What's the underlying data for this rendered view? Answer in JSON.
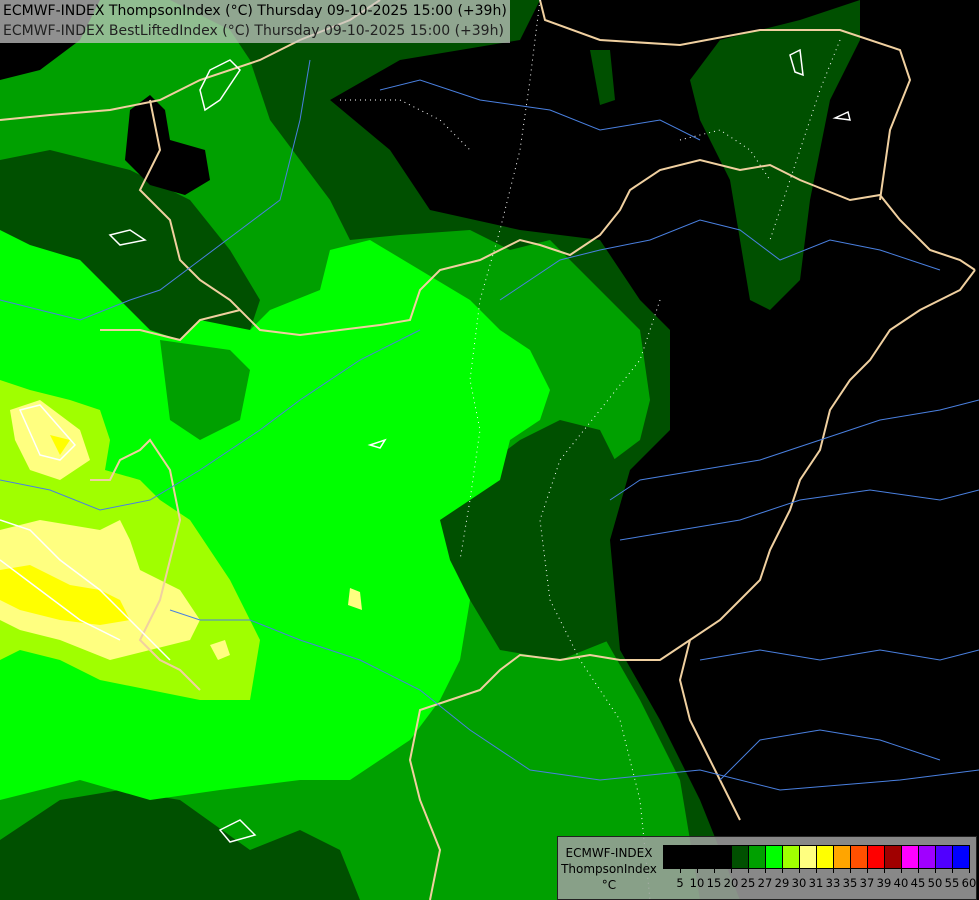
{
  "header": {
    "line1": "ECMWF-INDEX ThompsonIndex (°C) Thursday 09-10-2025 15:00 (+39h)",
    "line2": "ECMWF-INDEX BestLiftedIndex (°C) Thursday 09-10-2025 15:00 (+39h)"
  },
  "legend": {
    "title1": "ECMWF-INDEX",
    "title2": "ThompsonIndex",
    "unit": "°C",
    "labels": [
      "5",
      "10",
      "15",
      "20",
      "25",
      "27",
      "29",
      "30",
      "31",
      "33",
      "35",
      "37",
      "39",
      "40",
      "45",
      "50",
      "55",
      "60"
    ],
    "colors": [
      "#000000",
      "#000000",
      "#000000",
      "#000000",
      "#005000",
      "#00a000",
      "#00ff00",
      "#a0ff00",
      "#ffff80",
      "#ffff00",
      "#ffa500",
      "#ff5000",
      "#ff0000",
      "#a00000",
      "#ff00ff",
      "#a000ff",
      "#5000ff",
      "#0000ff"
    ]
  },
  "map_colors": {
    "background": "#000000",
    "dark_green": "#005000",
    "green": "#00a000",
    "bright_green": "#00ff00",
    "yellow_green": "#a0ff00",
    "pale_yellow": "#ffff80",
    "yellow": "#ffff00",
    "borders": "#f0d0a0",
    "rivers": "#4a80e0",
    "contours": "#ffffff"
  }
}
